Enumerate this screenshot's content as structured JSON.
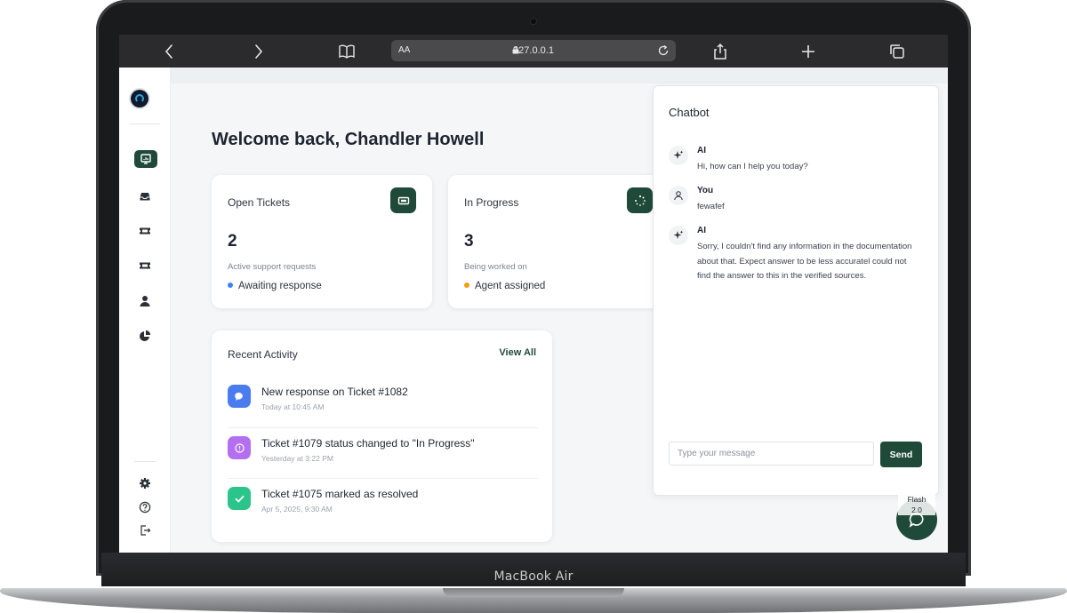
{
  "device": {
    "brand": "MacBook Air"
  },
  "browser": {
    "text_size_label": "AA",
    "url": "127.0.0.1",
    "icons": [
      "back-icon",
      "forward-icon",
      "bookmarks-icon",
      "reload-icon",
      "share-icon",
      "new-tab-icon",
      "tabs-icon"
    ]
  },
  "sidebar": {
    "items": [
      {
        "icon": "dashboard-icon",
        "active": true
      },
      {
        "icon": "inbox-icon"
      },
      {
        "icon": "ticket-icon"
      },
      {
        "icon": "ticket-alt-icon"
      },
      {
        "icon": "user-icon"
      },
      {
        "icon": "pie-chart-icon"
      }
    ],
    "bottom": [
      "settings-icon",
      "help-icon",
      "logout-icon"
    ]
  },
  "main": {
    "welcome": "Welcome back, Chandler Howell",
    "stats": [
      {
        "title": "Open Tickets",
        "value": "2",
        "subtitle": "Active support requests",
        "status": "Awaiting response",
        "status_color": "#3b82f6",
        "icon": "ticket-icon"
      },
      {
        "title": "In Progress",
        "value": "3",
        "subtitle": "Being worked on",
        "status": "Agent assigned",
        "status_color": "#f59e0b",
        "icon": "loader-icon"
      }
    ],
    "activity": {
      "title": "Recent Activity",
      "view_all": "View All",
      "items": [
        {
          "text": "New response on Ticket #1082",
          "time": "Today at 10:45 AM",
          "icon": "chat-bubble-icon",
          "color": "#4a7cf0"
        },
        {
          "text": "Ticket #1079 status changed to \"In Progress\"",
          "time": "Yesterday at 3:22 PM",
          "icon": "clock-icon",
          "color": "#b46ef0"
        },
        {
          "text": "Ticket #1075 marked as resolved",
          "time": "Apr 5, 2025, 9:30 AM",
          "icon": "check-icon",
          "color": "#2bc48a"
        }
      ]
    }
  },
  "chatbot": {
    "title": "Chatbot",
    "messages": [
      {
        "sender": "AI",
        "text": "Hi, how can I help you today?",
        "icon": "sparkle-icon"
      },
      {
        "sender": "You",
        "text": "fewafef",
        "icon": "user-icon"
      },
      {
        "sender": "AI",
        "text": "Sorry, I couldn't find any information in the documentation about that. Expect answer to be less accuratel could not find the answer to this in the verified sources.",
        "icon": "sparkle-icon"
      }
    ],
    "input_placeholder": "Type your message",
    "input_value": "",
    "send_label": "Send"
  },
  "fab": {
    "label_line1": "Flash",
    "label_line2": "2.0",
    "icon": "chat-icon"
  },
  "colors": {
    "brand_green": "#1f4a3a",
    "page_bg": "#f4f6f8"
  }
}
